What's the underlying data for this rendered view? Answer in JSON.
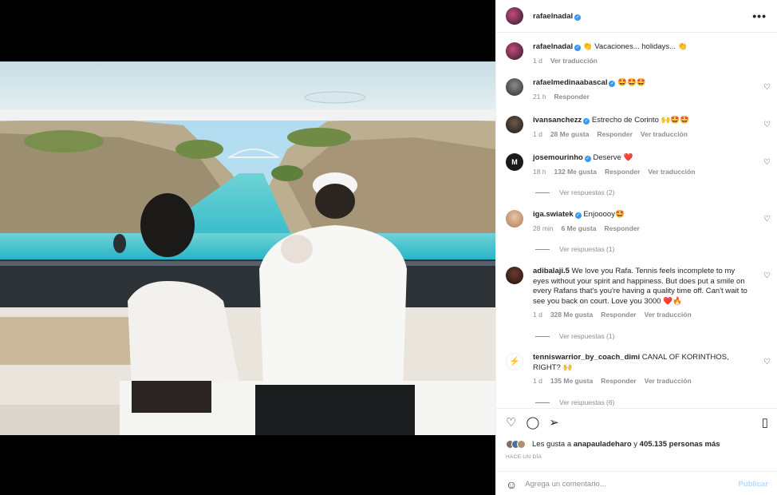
{
  "post": {
    "author": "rafaelnadal",
    "caption_author": "rafaelnadal",
    "caption": "👏 Vacaciones... holidays... 👏",
    "caption_time": "1 d",
    "caption_translate": "Ver traducción"
  },
  "comments": [
    {
      "user": "rafaelmedinaabascal",
      "text": "🤩🤩🤩",
      "time": "21 h",
      "likes": "",
      "reply": "Responder",
      "translate": ""
    },
    {
      "user": "ivansanchezz",
      "text": "Estrecho de Corinto 🙌🤩🤩",
      "time": "1 d",
      "likes": "28 Me gusta",
      "reply": "Responder",
      "translate": "Ver traducción"
    },
    {
      "user": "josemourinho",
      "text": "Deserve ❤️",
      "time": "18 h",
      "likes": "132 Me gusta",
      "reply": "Responder",
      "translate": "Ver traducción",
      "replies": "Ver respuestas (2)"
    },
    {
      "user": "iga.swiatek",
      "text": "Enjooooy🤩",
      "time": "28 min",
      "likes": "6 Me gusta",
      "reply": "Responder",
      "translate": "",
      "replies": "Ver respuestas (1)"
    },
    {
      "user": "adibalaji.5",
      "text": "We love you Rafa. Tennis feels incomplete to my eyes without your spirit and happiness. But does put a smile on every Rafans that's you're having a quality time off. Can't wait to see you back on court. Love you 3000 ❤️🔥",
      "time": "1 d",
      "likes": "328 Me gusta",
      "reply": "Responder",
      "translate": "Ver traducción",
      "replies": "Ver respuestas (1)"
    },
    {
      "user": "tenniswarrior_by_coach_dimi",
      "text": "CANAL OF KORINTHOS, RIGHT? 🙌",
      "time": "1 d",
      "likes": "135 Me gusta",
      "reply": "Responder",
      "translate": "Ver traducción",
      "replies": "Ver respuestas (6)"
    }
  ],
  "likes": {
    "prefix": "Les gusta a",
    "user": "anapauladeharo",
    "conj": "y",
    "others": "405.135 personas más"
  },
  "posted_when": "HACE UN DÍA",
  "compose": {
    "placeholder": "Agrega un comentario...",
    "publish": "Publicar"
  },
  "colors": {
    "verified": "#3897f0",
    "muted": "#8e8e8e",
    "publish": "#b3dbff",
    "water": "#3ec6cf",
    "sky": "#bfe3f2"
  },
  "icons": [
    "more-icon",
    "heart-icon",
    "comment-icon",
    "share-icon",
    "bookmark-icon",
    "emoji-icon",
    "verified-icon"
  ]
}
